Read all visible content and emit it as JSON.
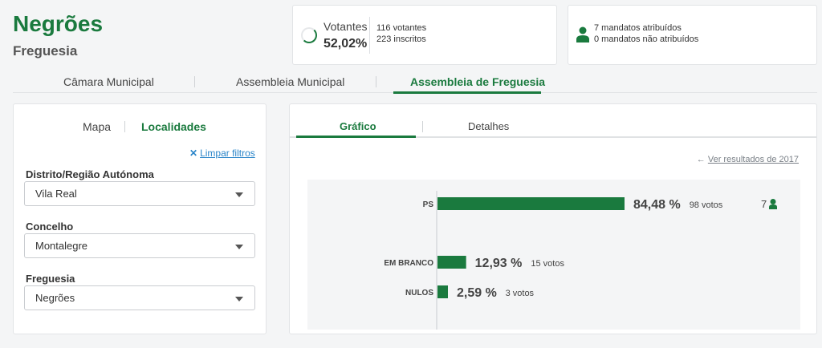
{
  "header": {
    "title": "Negrões",
    "subtitle": "Freguesia"
  },
  "votantes": {
    "label": "Votantes",
    "percent": "52,02%",
    "percent_value": 52.02,
    "votantes_text": "116 votantes",
    "inscritos_text": "223 inscritos"
  },
  "mandatos": {
    "atribuidos_text": "7 mandatos atribuídos",
    "nao_atribuidos_text": "0 mandatos não atribuídos",
    "icon": "person-icon"
  },
  "main_tabs": [
    {
      "label": "Câmara Municipal",
      "active": false
    },
    {
      "label": "Assembleia Municipal",
      "active": false
    },
    {
      "label": "Assembleia de Freguesia",
      "active": true
    }
  ],
  "filters": {
    "tabs": [
      {
        "label": "Mapa",
        "active": false
      },
      {
        "label": "Localidades",
        "active": true
      }
    ],
    "clear_label": "Limpar filtros",
    "clear_icon": "x-icon",
    "fields": [
      {
        "label": "Distrito/Região Autónoma",
        "value": "Vila Real"
      },
      {
        "label": "Concelho",
        "value": "Montalegre"
      },
      {
        "label": "Freguesia",
        "value": "Negrões"
      }
    ]
  },
  "results": {
    "tabs": [
      {
        "label": "Gráfico",
        "active": true
      },
      {
        "label": "Detalhes",
        "active": false
      }
    ],
    "prev_link": "Ver resultados de 2017",
    "accent_color": "#1a7a3e"
  },
  "chart_data": {
    "type": "bar",
    "orientation": "horizontal",
    "categories": [
      "PS",
      "EM BRANCO",
      "NULOS"
    ],
    "values": [
      84.48,
      12.93,
      2.59
    ],
    "value_labels": [
      "84,48 %",
      "12,93 %",
      "2,59 %"
    ],
    "votes_labels": [
      "98 votos",
      "15 votos",
      "3 votos"
    ],
    "mandates": [
      7,
      null,
      null
    ],
    "xlim": [
      0,
      100
    ],
    "grid": false,
    "color": "#1a7a3e"
  }
}
